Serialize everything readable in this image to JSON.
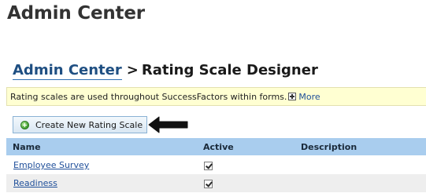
{
  "page": {
    "title": "Admin Center"
  },
  "breadcrumb": {
    "parent": "Admin Center",
    "separator": ">",
    "current": "Rating Scale Designer"
  },
  "info_bar": {
    "text": "Rating scales are used throughout SuccessFactors within forms.",
    "more_label": "More"
  },
  "toolbar": {
    "create_label": "Create New Rating Scale"
  },
  "table": {
    "headers": {
      "name": "Name",
      "active": "Active",
      "description": "Description"
    },
    "rows": [
      {
        "name": "Employee Survey",
        "active": true,
        "description": ""
      },
      {
        "name": "Readiness",
        "active": true,
        "description": ""
      }
    ]
  },
  "colors": {
    "header_bg": "#a9cdee",
    "info_bg": "#ffffd2",
    "link": "#1f4f9a"
  }
}
